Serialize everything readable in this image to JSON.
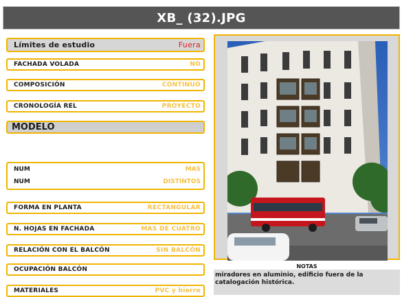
{
  "title": "XB_ (32).JPG",
  "limites": {
    "label": "Límites de estudio",
    "value": "Fuera"
  },
  "fields_top": [
    {
      "label": "FACHADA VOLADA",
      "value": "NO"
    },
    {
      "label": "COMPOSICIÓN",
      "value": "CONTINUO"
    },
    {
      "label": "CRONOLOGÍA REL",
      "value": "PROYECTO"
    }
  ],
  "section": {
    "label": "MODELO"
  },
  "num_rows": [
    {
      "label": "NUM",
      "value": "MAS"
    },
    {
      "label": "NUM",
      "value": "DISTINTOS"
    }
  ],
  "fields_bottom": [
    {
      "label": "FORMA EN PLANTA",
      "value": "RECTANGULAR"
    },
    {
      "label": "N. HOJAS EN FACHADA",
      "value": "MAS DE CUATRO"
    },
    {
      "label": "RELACIÓN CON EL BALCÓN",
      "value": "SIN BALCÓN"
    },
    {
      "label": "OCUPACIÓN BALCÓN",
      "value": ""
    },
    {
      "label": "MATERIALES",
      "value": "PVC y hierro"
    }
  ],
  "notes": {
    "title": "NOTAS",
    "lines": [
      "miradores en aluminio, edificio fuera de la",
      "catalogación histórica."
    ]
  },
  "colors": {
    "accent": "#f0b400",
    "value_text": "#f5c040",
    "title_bg": "#555555",
    "alert": "#e02020"
  }
}
